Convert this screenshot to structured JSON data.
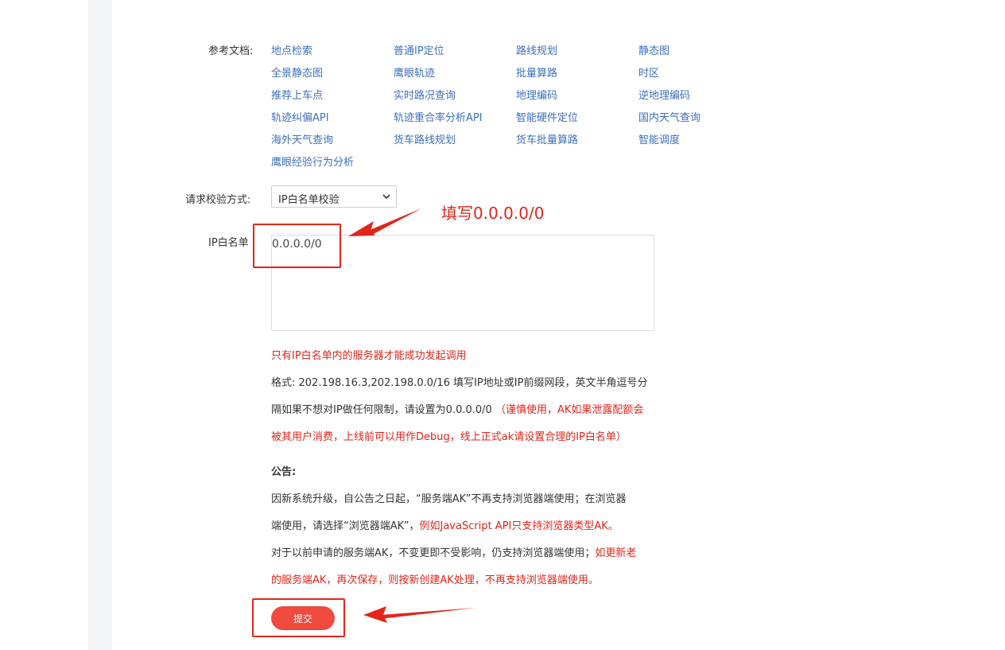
{
  "docs": {
    "label": "参考文档:",
    "links": [
      [
        "地点检索",
        "普通IP定位",
        "路线规划",
        "静态图"
      ],
      [
        "全景静态图",
        "鹰眼轨迹",
        "批量算路",
        "时区"
      ],
      [
        "推荐上车点",
        "实时路况查询",
        "地理编码",
        "逆地理编码"
      ],
      [
        "轨迹纠偏API",
        "轨迹重合率分析API",
        "智能硬件定位",
        "国内天气查询"
      ],
      [
        "海外天气查询",
        "货车路线规划",
        "货车批量算路",
        "智能调度"
      ],
      [
        "鹰眼经验行为分析"
      ]
    ]
  },
  "verify": {
    "label": "请求校验方式:",
    "selected": "IP白名单校验",
    "options": [
      "IP白名单校验"
    ]
  },
  "whitelist": {
    "label": "IP白名单",
    "value": "0.0.0.0/0",
    "annotation": "填写0.0.0.0/0",
    "tip_red": "只有IP白名单内的服务器才能成功发起调用",
    "format_line1": "格式: 202.198.16.3,202.198.0.0/16 填写IP地址或IP前缀网段，英文半角逗号分",
    "format_line2_black": "隔如果不想对IP做任何限制，请设置为0.0.0.0/0 ",
    "format_line2_red": "（谨慎使用，AK如果泄露配额会",
    "format_line3_red": "被其用户消费，上线前可以用作Debug，线上正式ak请设置合理的IP白名单）"
  },
  "notice": {
    "title": "公告:",
    "line1": "因新系统升级，自公告之日起，“服务端AK”不再支持浏览器端使用；在浏览器",
    "line2_black": "端使用，请选择“浏览器端AK”，",
    "line2_red": "例如JavaScript API只支持浏览器类型AK。",
    "line3_black": "对于以前申请的服务端AK，不变更即不受影响，仍支持浏览器端使用；",
    "line3_red": "如更新老",
    "line4_red": "的服务端AK，再次保存，则按新创建AK处理，不再支持浏览器端使用。"
  },
  "submit_label": "提交",
  "colors": {
    "accent": "#e1251b",
    "link": "#3c6fbf",
    "button": "#f0493e"
  }
}
